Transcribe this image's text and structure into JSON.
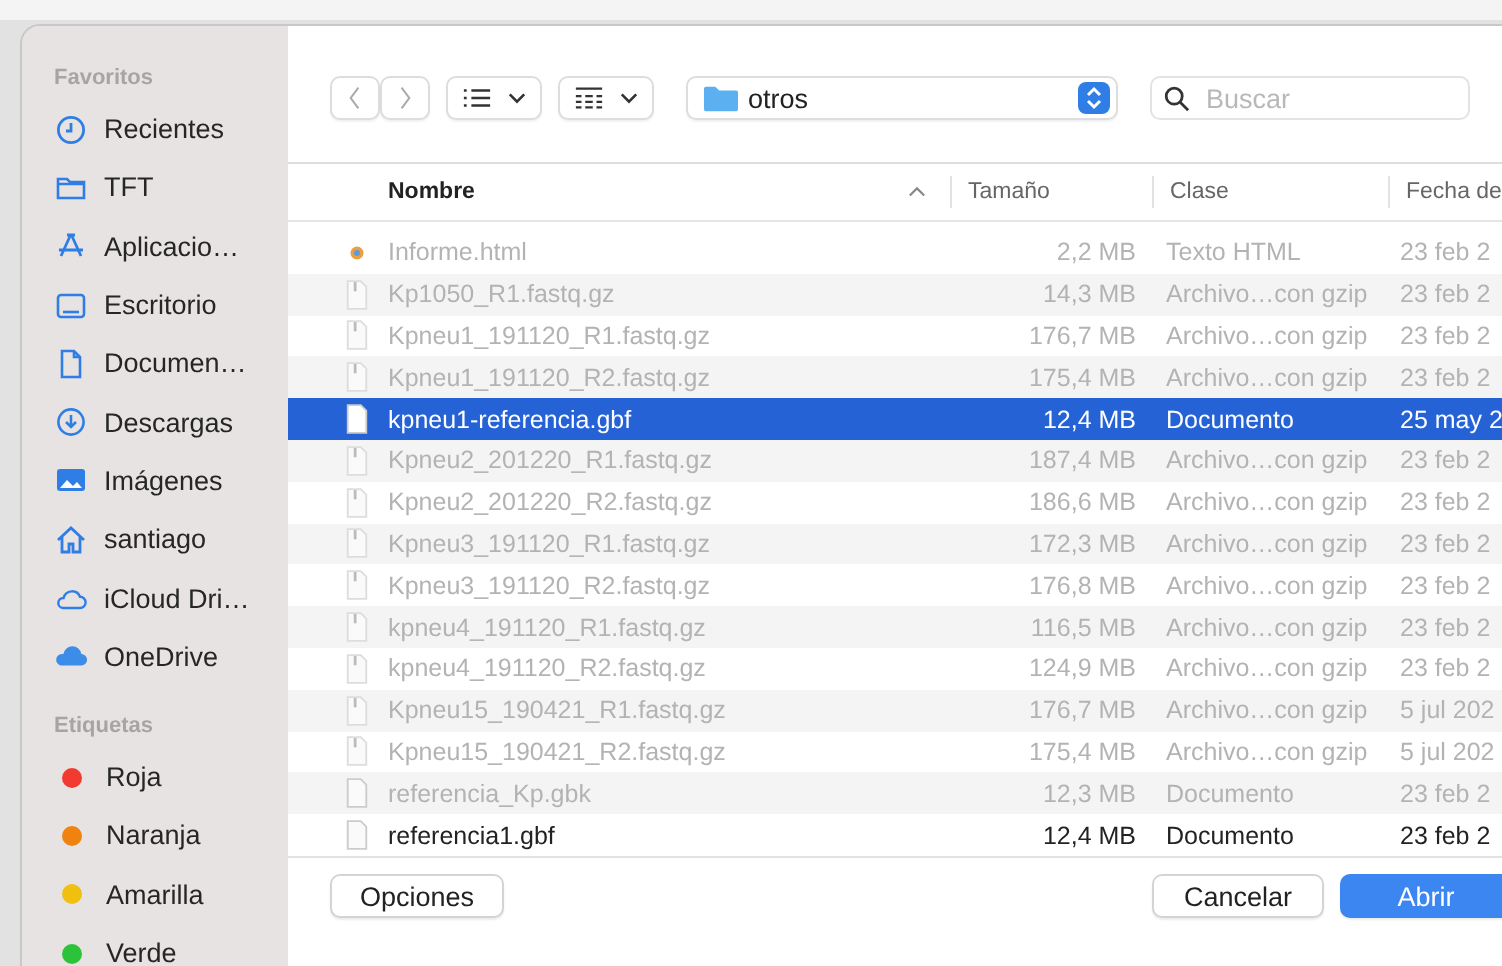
{
  "sidebar": {
    "sections": [
      {
        "title": "Favoritos",
        "items": [
          {
            "label": "Recientes",
            "kind": "clock"
          },
          {
            "label": "TFT",
            "kind": "folder"
          },
          {
            "label": "Aplicacio…",
            "kind": "apps"
          },
          {
            "label": "Escritorio",
            "kind": "desktop"
          },
          {
            "label": "Documen…",
            "kind": "document"
          },
          {
            "label": "Descargas",
            "kind": "download"
          },
          {
            "label": "Imágenes",
            "kind": "pictures"
          },
          {
            "label": "santiago",
            "kind": "home"
          },
          {
            "label": "iCloud Dri…",
            "kind": "cloud"
          },
          {
            "label": "OneDrive",
            "kind": "onedrive"
          }
        ]
      },
      {
        "title": "Etiquetas",
        "items": [
          {
            "label": "Roja",
            "kind": "tag",
            "color": "#f23b30"
          },
          {
            "label": "Naranja",
            "kind": "tag",
            "color": "#f0820f"
          },
          {
            "label": "Amarilla",
            "kind": "tag",
            "color": "#f0c010"
          },
          {
            "label": "Verde",
            "kind": "tag",
            "color": "#2cc23a"
          }
        ]
      }
    ]
  },
  "toolbar": {
    "path": "otros",
    "search": {
      "placeholder": "Buscar"
    }
  },
  "table": {
    "columns": [
      {
        "label": "Nombre",
        "sorted": true
      },
      {
        "label": "Tamaño",
        "sorted": false
      },
      {
        "label": "Clase",
        "sorted": false
      },
      {
        "label": "Fecha de",
        "sorted": false
      }
    ],
    "rows": [
      {
        "name": "Informe.html",
        "size": "2,2 MB",
        "type": "Texto HTML",
        "date": "23 feb 2",
        "kind": "web",
        "disabled": true,
        "selected": false
      },
      {
        "name": "Kp1050_R1.fastq.gz",
        "size": "14,3 MB",
        "type": "Archivo…con gzip",
        "date": "23 feb 2",
        "kind": "archive",
        "disabled": true,
        "selected": false
      },
      {
        "name": "Kpneu1_191120_R1.fastq.gz",
        "size": "176,7 MB",
        "type": "Archivo…con gzip",
        "date": "23 feb 2",
        "kind": "archive",
        "disabled": true,
        "selected": false
      },
      {
        "name": "Kpneu1_191120_R2.fastq.gz",
        "size": "175,4 MB",
        "type": "Archivo…con gzip",
        "date": "23 feb 2",
        "kind": "archive",
        "disabled": true,
        "selected": false
      },
      {
        "name": "kpneu1-referencia.gbf",
        "size": "12,4 MB",
        "type": "Documento",
        "date": "25 may 2",
        "kind": "document",
        "disabled": false,
        "selected": true
      },
      {
        "name": "Kpneu2_201220_R1.fastq.gz",
        "size": "187,4 MB",
        "type": "Archivo…con gzip",
        "date": "23 feb 2",
        "kind": "archive",
        "disabled": true,
        "selected": false
      },
      {
        "name": "Kpneu2_201220_R2.fastq.gz",
        "size": "186,6 MB",
        "type": "Archivo…con gzip",
        "date": "23 feb 2",
        "kind": "archive",
        "disabled": true,
        "selected": false
      },
      {
        "name": "Kpneu3_191120_R1.fastq.gz",
        "size": "172,3 MB",
        "type": "Archivo…con gzip",
        "date": "23 feb 2",
        "kind": "archive",
        "disabled": true,
        "selected": false
      },
      {
        "name": "Kpneu3_191120_R2.fastq.gz",
        "size": "176,8 MB",
        "type": "Archivo…con gzip",
        "date": "23 feb 2",
        "kind": "archive",
        "disabled": true,
        "selected": false
      },
      {
        "name": "kpneu4_191120_R1.fastq.gz",
        "size": "116,5 MB",
        "type": "Archivo…con gzip",
        "date": "23 feb 2",
        "kind": "archive",
        "disabled": true,
        "selected": false
      },
      {
        "name": "kpneu4_191120_R2.fastq.gz",
        "size": "124,9 MB",
        "type": "Archivo…con gzip",
        "date": "23 feb 2",
        "kind": "archive",
        "disabled": true,
        "selected": false
      },
      {
        "name": "Kpneu15_190421_R1.fastq.gz",
        "size": "176,7 MB",
        "type": "Archivo…con gzip",
        "date": "5 jul 202",
        "kind": "archive",
        "disabled": true,
        "selected": false
      },
      {
        "name": "Kpneu15_190421_R2.fastq.gz",
        "size": "175,4 MB",
        "type": "Archivo…con gzip",
        "date": "5 jul 202",
        "kind": "archive",
        "disabled": true,
        "selected": false
      },
      {
        "name": "referencia_Kp.gbk",
        "size": "12,3 MB",
        "type": "Documento",
        "date": "23 feb 2",
        "kind": "document",
        "disabled": true,
        "selected": false
      },
      {
        "name": "referencia1.gbf",
        "size": "12,4 MB",
        "type": "Documento",
        "date": "23 feb 2",
        "kind": "document",
        "disabled": false,
        "selected": false
      }
    ]
  },
  "buttons": [
    {
      "label": "Opciones",
      "kind": "plain"
    },
    {
      "label": "Cancelar",
      "kind": "plain"
    },
    {
      "label": "Abrir",
      "kind": "default"
    }
  ]
}
